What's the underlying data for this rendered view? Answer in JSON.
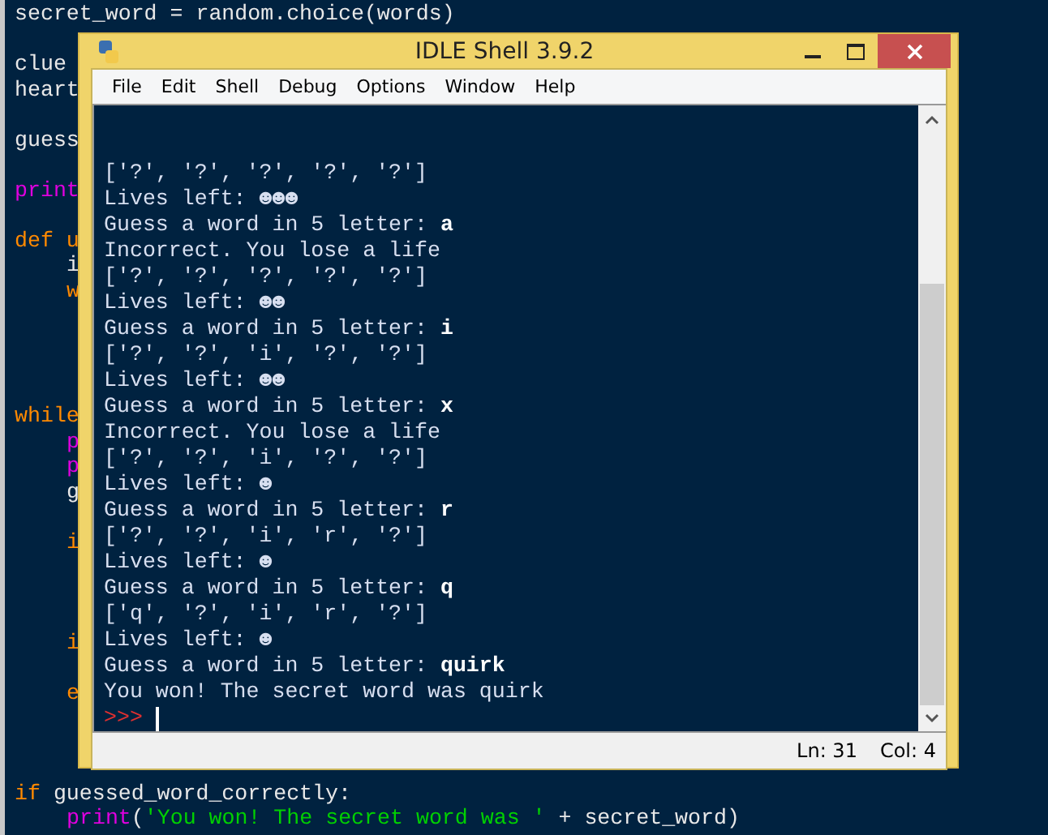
{
  "editor": {
    "lines": [
      {
        "kind": "code",
        "indented": false,
        "segments": [
          {
            "text": "secret_word = random.choice(words)",
            "kind": "plain"
          }
        ]
      },
      {
        "kind": "blank"
      },
      {
        "kind": "code",
        "indented": false,
        "segments": [
          {
            "text": "clue",
            "kind": "plain"
          }
        ]
      },
      {
        "kind": "code",
        "indented": false,
        "segments": [
          {
            "text": "heart",
            "kind": "plain"
          }
        ]
      },
      {
        "kind": "blank"
      },
      {
        "kind": "code",
        "indented": false,
        "segments": [
          {
            "text": "guess",
            "kind": "plain"
          }
        ]
      },
      {
        "kind": "blank"
      },
      {
        "kind": "code",
        "indented": false,
        "segments": [
          {
            "text": "print",
            "kind": "builtin"
          }
        ]
      },
      {
        "kind": "blank"
      },
      {
        "kind": "code",
        "indented": false,
        "segments": [
          {
            "text": "def u",
            "kind": "keyword"
          }
        ]
      },
      {
        "kind": "code",
        "indented": true,
        "segments": [
          {
            "text": "i",
            "kind": "plain"
          }
        ]
      },
      {
        "kind": "code",
        "indented": true,
        "segments": [
          {
            "text": "w",
            "kind": "keyword"
          }
        ]
      },
      {
        "kind": "blank"
      },
      {
        "kind": "blank"
      },
      {
        "kind": "blank"
      },
      {
        "kind": "blank"
      },
      {
        "kind": "code",
        "indented": false,
        "segments": [
          {
            "text": "while",
            "kind": "keyword"
          }
        ]
      },
      {
        "kind": "code",
        "indented": true,
        "segments": [
          {
            "text": "p",
            "kind": "builtin"
          }
        ]
      },
      {
        "kind": "code",
        "indented": true,
        "segments": [
          {
            "text": "p",
            "kind": "builtin"
          }
        ]
      },
      {
        "kind": "code",
        "indented": true,
        "segments": [
          {
            "text": "g",
            "kind": "plain"
          }
        ]
      },
      {
        "kind": "blank"
      },
      {
        "kind": "code",
        "indented": true,
        "segments": [
          {
            "text": "i",
            "kind": "keyword"
          }
        ]
      },
      {
        "kind": "blank"
      },
      {
        "kind": "blank"
      },
      {
        "kind": "blank"
      },
      {
        "kind": "code",
        "indented": true,
        "segments": [
          {
            "text": "i",
            "kind": "keyword"
          }
        ]
      },
      {
        "kind": "blank"
      },
      {
        "kind": "code",
        "indented": true,
        "segments": [
          {
            "text": "e",
            "kind": "keyword"
          }
        ]
      },
      {
        "kind": "blank"
      },
      {
        "kind": "blank"
      },
      {
        "kind": "blank"
      },
      {
        "kind": "code",
        "indented": false,
        "segments": [
          {
            "text": "if",
            "kind": "keyword"
          },
          {
            "text": " guessed_word_correctly:",
            "kind": "plain"
          }
        ]
      },
      {
        "kind": "code",
        "indented": true,
        "segments": [
          {
            "text": "print",
            "kind": "builtin"
          },
          {
            "text": "(",
            "kind": "plain"
          },
          {
            "text": "'You won! The secret word was '",
            "kind": "string"
          },
          {
            "text": " + secret_word)",
            "kind": "plain"
          }
        ]
      }
    ]
  },
  "window": {
    "title": "IDLE Shell 3.9.2",
    "menu": [
      "File",
      "Edit",
      "Shell",
      "Debug",
      "Options",
      "Window",
      "Help"
    ],
    "shell_lines": [
      {
        "kind": "output",
        "text": "['?', '?', '?', '?', '?']"
      },
      {
        "kind": "output",
        "text": "Lives left: ☻☻☻"
      },
      {
        "kind": "output",
        "text": "Guess a word in 5 letter: ",
        "input": "a"
      },
      {
        "kind": "output",
        "text": "Incorrect. You lose a life"
      },
      {
        "kind": "output",
        "text": "['?', '?', '?', '?', '?']"
      },
      {
        "kind": "output",
        "text": "Lives left: ☻☻"
      },
      {
        "kind": "output",
        "text": "Guess a word in 5 letter: ",
        "input": "i"
      },
      {
        "kind": "output",
        "text": "['?', '?', 'i', '?', '?']"
      },
      {
        "kind": "output",
        "text": "Lives left: ☻☻"
      },
      {
        "kind": "output",
        "text": "Guess a word in 5 letter: ",
        "input": "x"
      },
      {
        "kind": "output",
        "text": "Incorrect. You lose a life"
      },
      {
        "kind": "output",
        "text": "['?', '?', 'i', '?', '?']"
      },
      {
        "kind": "output",
        "text": "Lives left: ☻"
      },
      {
        "kind": "output",
        "text": "Guess a word in 5 letter: ",
        "input": "r"
      },
      {
        "kind": "output",
        "text": "['?', '?', 'i', 'r', '?']"
      },
      {
        "kind": "output",
        "text": "Lives left: ☻"
      },
      {
        "kind": "output",
        "text": "Guess a word in 5 letter: ",
        "input": "q"
      },
      {
        "kind": "output",
        "text": "['q', '?', 'i', 'r', '?']"
      },
      {
        "kind": "output",
        "text": "Lives left: ☻"
      },
      {
        "kind": "output",
        "text": "Guess a word in 5 letter: ",
        "input": "quirk"
      },
      {
        "kind": "output",
        "text": "You won! The secret word was quirk"
      },
      {
        "kind": "prompt",
        "text": ">>>"
      }
    ],
    "status_bar": {
      "line": "Ln: 31",
      "column": "Col: 4"
    }
  }
}
